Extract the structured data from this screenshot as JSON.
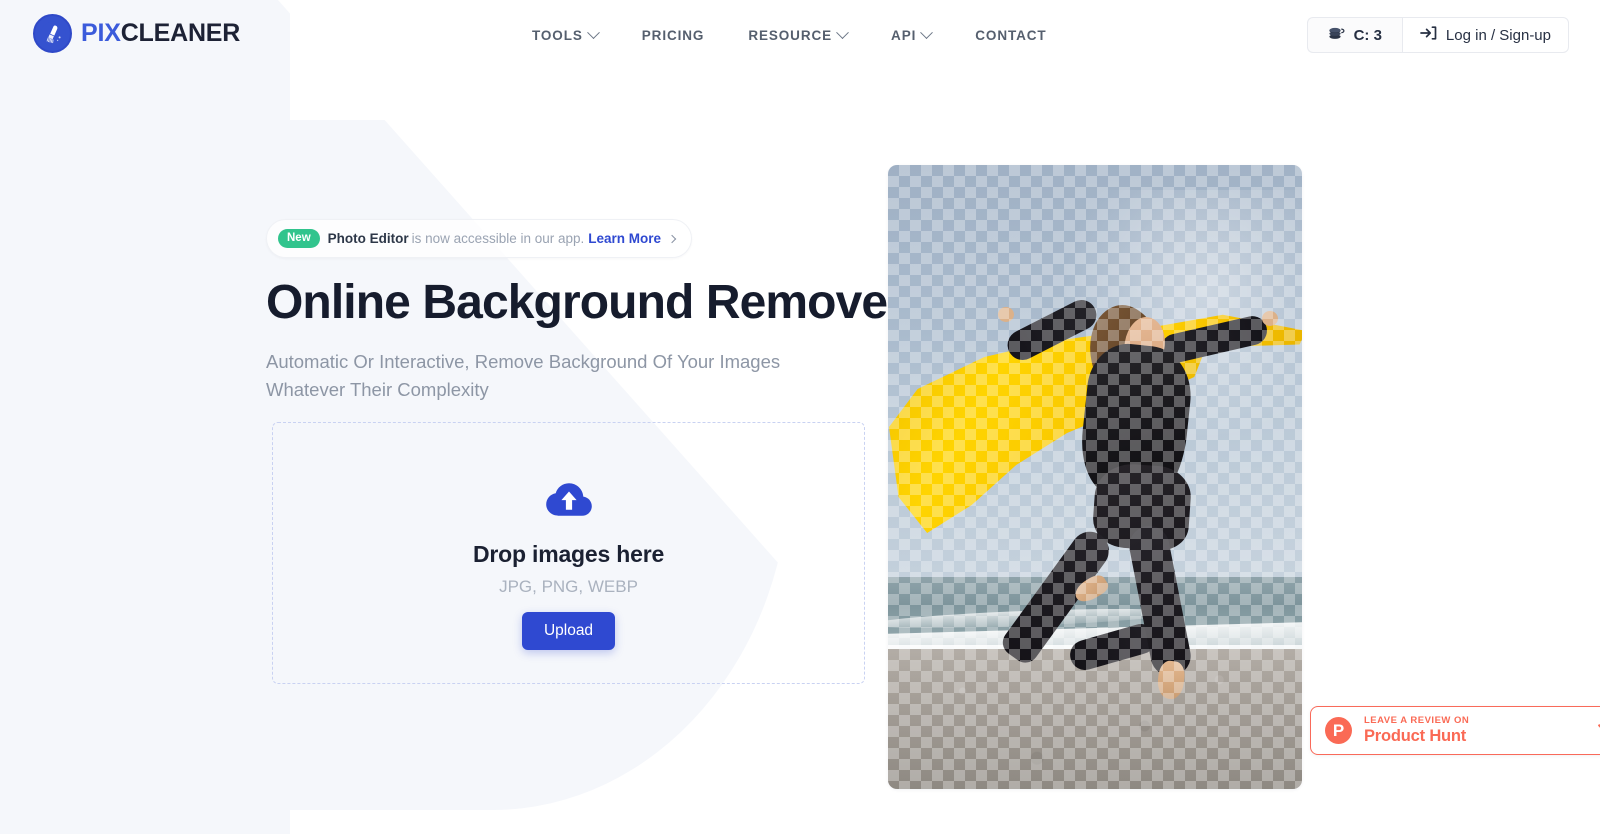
{
  "brand": {
    "logo_pix": "PIX",
    "logo_cleaner": "CLEANER",
    "logo_icon": "brush-circle-icon",
    "accent_blue": "#2f49d1",
    "logo_blue": "#3b5bdb",
    "dark_navy": "#1d2235"
  },
  "nav": {
    "items": [
      {
        "label": "TOOLS",
        "has_dropdown": true
      },
      {
        "label": "PRICING",
        "has_dropdown": false
      },
      {
        "label": "RESOURCE",
        "has_dropdown": true
      },
      {
        "label": "API",
        "has_dropdown": true
      },
      {
        "label": "CONTACT",
        "has_dropdown": false
      }
    ]
  },
  "header_actions": {
    "credits_label": "C: 3",
    "credits_icon": "coins-icon",
    "login_label": "Log in / Sign-up",
    "login_icon": "sign-in-icon"
  },
  "announcement": {
    "badge": "New",
    "badge_color": "#31c48d",
    "bold_text": "Photo Editor",
    "text": "is now accessible in our app.",
    "link": "Learn More",
    "chevron_icon": "chevron-right-icon"
  },
  "hero": {
    "headline": "Online Background Remover",
    "subheadline": "Automatic Or Interactive, Remove Background Of Your Images Whatever Their Complexity"
  },
  "dropzone": {
    "icon": "cloud-upload-icon",
    "title": "Drop images here",
    "formats": "JPG, PNG, WEBP",
    "button_label": "Upload"
  },
  "preview": {
    "alt": "woman-jumping-on-beach-with-yellow-fabric-transparent-background",
    "transparency_grid": true
  },
  "product_hunt": {
    "logo_letter": "P",
    "small_label": "LEAVE A REVIEW ON",
    "big_label": "Product Hunt",
    "star_icon": "star-outline-icon",
    "accent_color": "#fa6a55"
  }
}
